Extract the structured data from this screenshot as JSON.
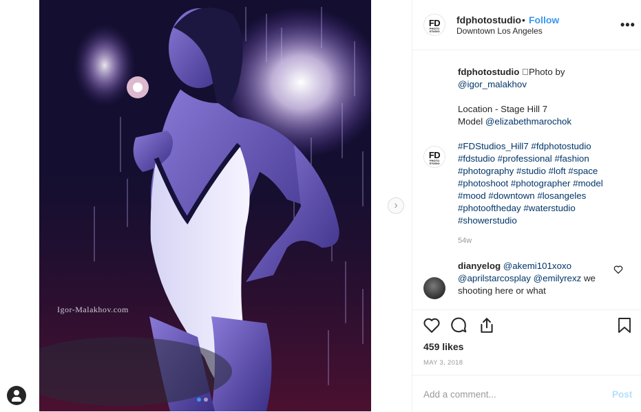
{
  "post": {
    "username": "fdphotostudio",
    "dot": "•",
    "follow_label": "Follow",
    "location": "Downtown Los Angeles",
    "more_label": "•••",
    "logo_fd": "FD",
    "logo_sub": "PHOTO STUDIO",
    "watermark": "Igor-Malakhov.com",
    "next_arrow": "›"
  },
  "caption": {
    "username": "fdphotostudio",
    "line1_text": " \u0000Photo by",
    "photo_by": "@igor_malakhov",
    "location_line": "Location - Stage Hill 7",
    "model_label": "Model ",
    "model": "@elizabethmarochok",
    "hashtag_lines": [
      "#FDStudios_Hill7 #fdphotostudio",
      "#fdstudio #professional #fashion",
      "#photography #studio #loft #space",
      "#photoshoot #photographer #model",
      "#mood #downtown #losangeles",
      "#photooftheday #waterstudio",
      "#showerstudio"
    ],
    "age": "54w"
  },
  "comment": {
    "username": "dianyelog",
    "mention1": "@akemi101xoxo",
    "mention2": "@aprilstarcosplay",
    "mention3": "@emilyrexz",
    "text_tail": " we",
    "line3": "shooting here or what"
  },
  "stats": {
    "likes": "459 likes",
    "date": "MAY 3, 2018"
  },
  "add_comment": {
    "placeholder": "Add a comment...",
    "post_label": "Post"
  },
  "icons": {
    "heart": "heart-icon",
    "comment": "comment-icon",
    "share": "share-icon",
    "bookmark": "bookmark-icon",
    "more": "more-icon",
    "next": "chevron-right-icon",
    "user": "user-icon"
  },
  "colors": {
    "accent": "#3897f0",
    "link": "#003569",
    "muted": "#999999",
    "post_disabled": "#b2dffc"
  },
  "carousel": {
    "count": 2,
    "active": 0
  }
}
